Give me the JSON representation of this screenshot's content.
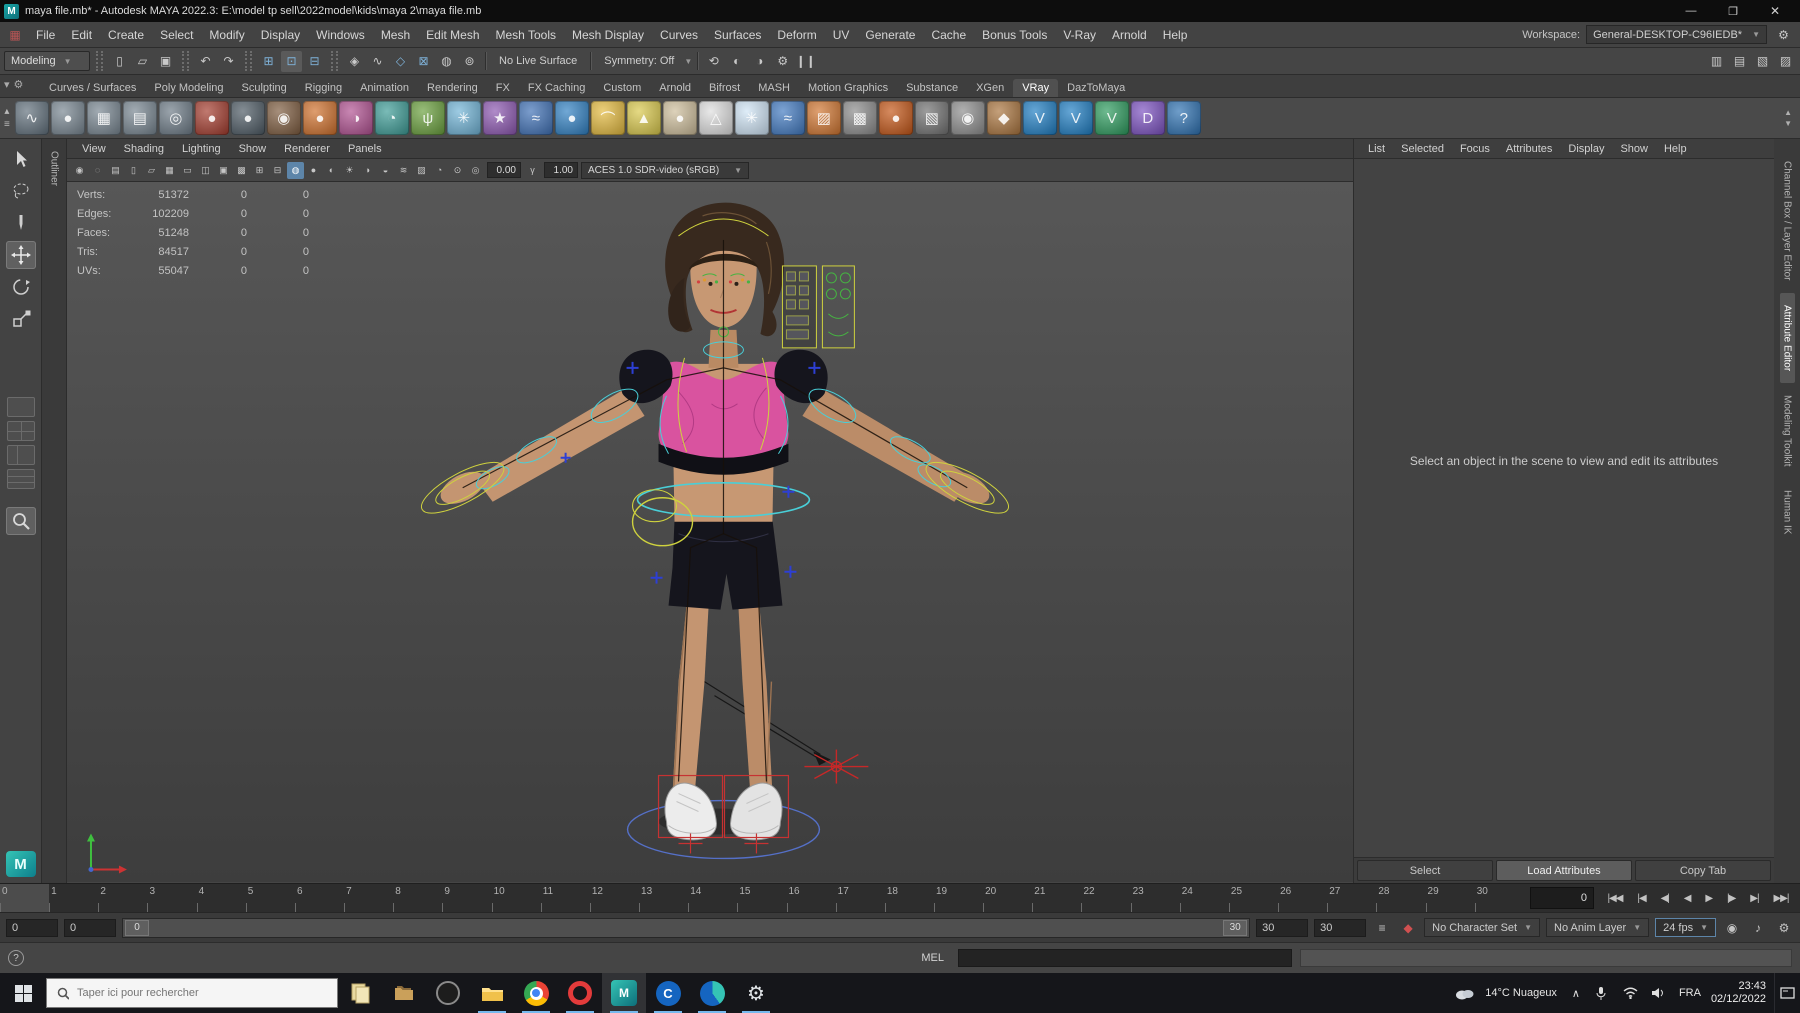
{
  "window": {
    "title": "maya file.mb* - Autodesk MAYA 2022.3: E:\\model tp sell\\2022model\\kids\\maya 2\\maya file.mb"
  },
  "menu_bar": {
    "items": [
      "File",
      "Edit",
      "Create",
      "Select",
      "Modify",
      "Display",
      "Windows",
      "Mesh",
      "Edit Mesh",
      "Mesh Tools",
      "Mesh Display",
      "Curves",
      "Surfaces",
      "Deform",
      "UV",
      "Generate",
      "Cache",
      "Bonus Tools",
      "V-Ray",
      "Arnold",
      "Help"
    ]
  },
  "workspace": {
    "label": "Workspace:",
    "value": "General-DESKTOP-C96IEDB*"
  },
  "status": {
    "mode": "Modeling",
    "live_surface": "No Live Surface",
    "symmetry": "Symmetry: Off"
  },
  "shelf": {
    "active_tab": "VRay",
    "tabs": [
      "Curves / Surfaces",
      "Poly Modeling",
      "Sculpting",
      "Rigging",
      "Animation",
      "Rendering",
      "FX",
      "FX Caching",
      "Custom",
      "Arnold",
      "Bifrost",
      "MASH",
      "Motion Graphics",
      "Substance",
      "XGen",
      "VRay",
      "DazToMaya"
    ],
    "icons": [
      {
        "name": "curve-tool-icon",
        "bg": "#5f6e7a",
        "glyph": "∿"
      },
      {
        "name": "poly-sphere-icon",
        "bg": "#76848f",
        "glyph": "●"
      },
      {
        "name": "poly-cube-icon",
        "bg": "#76848f",
        "glyph": "▦"
      },
      {
        "name": "poly-plane-icon",
        "bg": "#76848f",
        "glyph": "▤"
      },
      {
        "name": "poly-torus-icon",
        "bg": "#6b7985",
        "glyph": "◎"
      },
      {
        "name": "red-shader-ball-icon",
        "bg": "#a33a2c",
        "glyph": "●"
      },
      {
        "name": "dark-shader-ball-icon",
        "bg": "#4b5862",
        "glyph": "●"
      },
      {
        "name": "granite-ball-icon",
        "bg": "#7c5a3d",
        "glyph": "◉"
      },
      {
        "name": "orange-shader-ball-icon",
        "bg": "#cf6f2a",
        "glyph": "●"
      },
      {
        "name": "ramp-ball-icon",
        "bg": "#b04f90",
        "glyph": "◑"
      },
      {
        "name": "checker-ball-icon",
        "bg": "#3b9b95",
        "glyph": "◔"
      },
      {
        "name": "paint-grass-icon",
        "bg": "#689f3b",
        "glyph": "ψ"
      },
      {
        "name": "paint-flowers-icon",
        "bg": "#6fb3d6",
        "glyph": "✳"
      },
      {
        "name": "fireworks-fx-icon",
        "bg": "#8b55b0",
        "glyph": "★"
      },
      {
        "name": "swirl-fx-icon",
        "bg": "#3d6fb5",
        "glyph": "≈"
      },
      {
        "name": "blue-shader-ball-icon",
        "bg": "#2e7fc2",
        "glyph": "●"
      },
      {
        "name": "yellow-dome-icon",
        "bg": "#e3b93c",
        "glyph": "⌒"
      },
      {
        "name": "cone-primitive-icon",
        "bg": "#d9c84a",
        "glyph": "▲"
      },
      {
        "name": "sand-ball-icon",
        "bg": "#cdbd9a",
        "glyph": "●"
      },
      {
        "name": "white-cone-icon",
        "bg": "#dedede",
        "glyph": "△"
      },
      {
        "name": "snow-fx-icon",
        "bg": "#cfe4f5",
        "glyph": "✳"
      },
      {
        "name": "water-plane-icon",
        "bg": "#3f78c0",
        "glyph": "≈"
      },
      {
        "name": "stripe-texture-icon",
        "bg": "#d0742e",
        "glyph": "▨"
      },
      {
        "name": "checker-texture-icon",
        "bg": "#8a8a8a",
        "glyph": "▩"
      },
      {
        "name": "substance-ball-icon",
        "bg": "#c35414",
        "glyph": "●"
      },
      {
        "name": "uv-tool-icon",
        "bg": "#6f6f6f",
        "glyph": "▧"
      },
      {
        "name": "camera-tool-icon",
        "bg": "#8c8c8c",
        "glyph": "◉"
      },
      {
        "name": "cloth-tool-icon",
        "bg": "#a9733c",
        "glyph": "◆"
      },
      {
        "name": "vray-tool-1-icon",
        "bg": "#1c7cc2",
        "glyph": "V"
      },
      {
        "name": "vray-tool-2-icon",
        "bg": "#1c7cc2",
        "glyph": "V"
      },
      {
        "name": "vray-tool-3-icon",
        "bg": "#2a9a5c",
        "glyph": "V"
      },
      {
        "name": "daz-to-maya-icon",
        "bg": "#7a4fc0",
        "glyph": "D"
      },
      {
        "name": "help-shelf-icon",
        "bg": "#2b6fb0",
        "glyph": "?"
      }
    ]
  },
  "left_strip": {
    "label": "Outliner"
  },
  "viewport": {
    "menus": [
      "View",
      "Shading",
      "Lighting",
      "Show",
      "Renderer",
      "Panels"
    ],
    "toolbar": {
      "exposure": "0.00",
      "gamma": "1.00",
      "colorspace": "ACES 1.0 SDR-video (sRGB)"
    }
  },
  "hud": {
    "rows": [
      {
        "label": "Verts:",
        "value": "51372",
        "z1": "0",
        "z2": "0"
      },
      {
        "label": "Edges:",
        "value": "102209",
        "z1": "0",
        "z2": "0"
      },
      {
        "label": "Faces:",
        "value": "51248",
        "z1": "0",
        "z2": "0"
      },
      {
        "label": "Tris:",
        "value": "84517",
        "z1": "0",
        "z2": "0"
      },
      {
        "label": "UVs:",
        "value": "55047",
        "z1": "0",
        "z2": "0"
      }
    ]
  },
  "attribute_editor": {
    "menus": [
      "List",
      "Selected",
      "Focus",
      "Attributes",
      "Display",
      "Show",
      "Help"
    ],
    "message": "Select an object in the scene to view and edit its attributes",
    "buttons": [
      "Select",
      "Load Attributes",
      "Copy Tab"
    ]
  },
  "right_tabs": [
    "Channel Box / Layer Editor",
    "Attribute Editor",
    "Modeling Toolkit",
    "Human IK"
  ],
  "right_active_tab": "Attribute Editor",
  "timeline": {
    "labels": [
      "0",
      "1",
      "2",
      "3",
      "4",
      "5",
      "6",
      "7",
      "8",
      "9",
      "10",
      "11",
      "12",
      "13",
      "14",
      "15",
      "16",
      "17",
      "18",
      "19",
      "20",
      "21",
      "22",
      "23",
      "24",
      "25",
      "26",
      "27",
      "28",
      "29",
      "30"
    ],
    "current": "0"
  },
  "range": {
    "anim_start": "0",
    "play_start": "0",
    "slider_start": "0",
    "slider_end": "30",
    "play_end": "30",
    "anim_end": "30",
    "character_set": "No Character Set",
    "anim_layer": "No Anim Layer",
    "fps": "24 fps"
  },
  "command": {
    "mode": "MEL"
  },
  "taskbar": {
    "search_placeholder": "Taper ici pour rechercher",
    "weather": "14°C Nuageux",
    "language": "FRA",
    "time": "23:43",
    "date": "02/12/2022"
  }
}
